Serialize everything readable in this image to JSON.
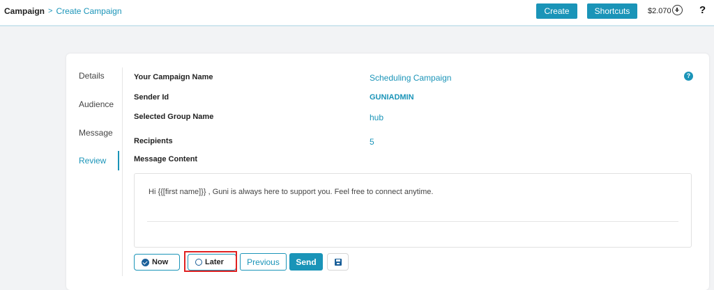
{
  "header": {
    "breadcrumb": {
      "root": "Campaign",
      "separator": ">",
      "current": "Create Campaign"
    },
    "create_label": "Create",
    "shortcuts_label": "Shortcuts",
    "balance": "$2.070",
    "help_label": "?"
  },
  "steps": [
    {
      "label": "Details"
    },
    {
      "label": "Audience"
    },
    {
      "label": "Message"
    },
    {
      "label": "Review",
      "active": true
    }
  ],
  "review": {
    "campaign_name": {
      "label": "Your Campaign Name",
      "value": "Scheduling Campaign"
    },
    "sender_id": {
      "label": "Sender Id",
      "value": "GUNIADMIN"
    },
    "group_name": {
      "label": "Selected Group Name",
      "value": "hub"
    },
    "recipients": {
      "label": "Recipients",
      "value": "5"
    },
    "message_content": {
      "label": "Message Content",
      "text": "Hi {{[first name]}} , Guni is always here to support you. Feel free to connect anytime."
    },
    "help_label": "?"
  },
  "schedule": {
    "now_label": "Now",
    "later_label": "Later",
    "selected": "now"
  },
  "actions": {
    "previous_label": "Previous",
    "send_label": "Send"
  },
  "colors": {
    "accent": "#1a94b8",
    "radio": "#1a5f99",
    "highlight": "#e02020"
  },
  "icons": {
    "balance_add": "plus-circle-icon",
    "save": "save-icon",
    "now_radio": "radio-checked-icon",
    "later_radio": "radio-empty-icon"
  }
}
